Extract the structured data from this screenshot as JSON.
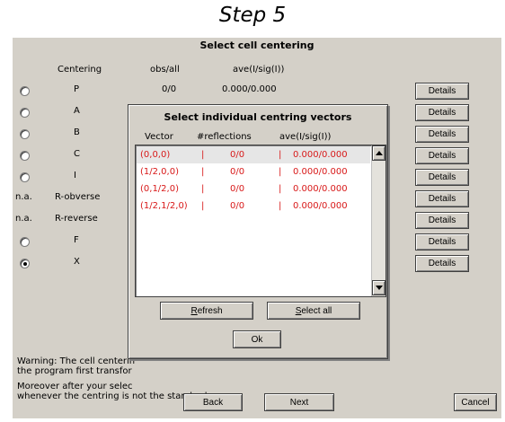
{
  "step_title": "Step 5",
  "window": {
    "title": "Select cell centering",
    "headers": {
      "centering": "Centering",
      "obs": "obs/all",
      "ave": "ave(I/sig(I))"
    },
    "rows": [
      {
        "mark": "radio",
        "selected": false,
        "centering": "P",
        "obs": "0/0",
        "ave": "0.000/0.000",
        "details": "Details"
      },
      {
        "mark": "radio",
        "selected": false,
        "centering": "A",
        "details": "Details"
      },
      {
        "mark": "radio",
        "selected": false,
        "centering": "B",
        "details": "Details"
      },
      {
        "mark": "radio",
        "selected": false,
        "centering": "C",
        "details": "Details"
      },
      {
        "mark": "radio",
        "selected": false,
        "centering": "I",
        "details": "Details"
      },
      {
        "mark": "n.a.",
        "selected": false,
        "centering": "R-obverse",
        "details": "Details"
      },
      {
        "mark": "n.a.",
        "selected": false,
        "centering": "R-reverse",
        "details": "Details"
      },
      {
        "mark": "radio",
        "selected": false,
        "centering": "F",
        "details": "Details"
      },
      {
        "mark": "radio",
        "selected": true,
        "centering": "X",
        "details": "Details"
      }
    ],
    "warning": {
      "line1": "Warning: The cell centerin",
      "line2": "the program first transfor",
      "line3": "Moreover after your selec",
      "line4": "whenever the centring is not the standard one."
    },
    "buttons": {
      "back": "Back",
      "next": "Next",
      "cancel": "Cancel"
    }
  },
  "dialog": {
    "title": "Select individual centring vectors",
    "headers": {
      "vector": "Vector",
      "reflections": "#reflections",
      "ave": "ave(I/sig(I))"
    },
    "separator": "|",
    "rows": [
      {
        "vector": "(0,0,0)",
        "reflections": "0/0",
        "ave": "0.000/0.000"
      },
      {
        "vector": "(1/2,0,0)",
        "reflections": "0/0",
        "ave": "0.000/0.000"
      },
      {
        "vector": "(0,1/2,0)",
        "reflections": "0/0",
        "ave": "0.000/0.000"
      },
      {
        "vector": "(1/2,1/2,0)",
        "reflections": "0/0",
        "ave": "0.000/0.000"
      }
    ],
    "buttons": {
      "refresh_first": "R",
      "refresh_rest": "efresh",
      "select_all_first": "S",
      "select_all_rest": "elect all",
      "ok": "Ok"
    },
    "colors": {
      "list_text": "#d81818",
      "selected_row": "#e6e6e6"
    }
  }
}
